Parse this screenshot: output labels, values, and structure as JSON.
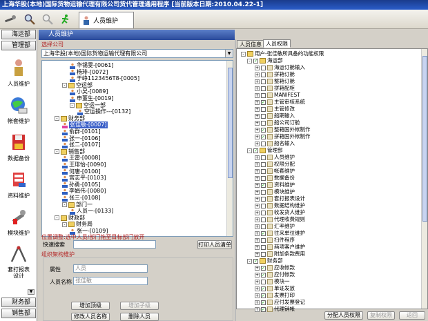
{
  "window": {
    "title": "上海华股(本地)国际货物运输代理有限公司货代管理通用程序   [当前版本日期:2010.04.22-1]"
  },
  "toolbar": {
    "tab_label": "人员维护"
  },
  "leftnav": {
    "group1": "海运部",
    "group2": "管理部",
    "items": [
      "人员维护",
      "帐套维护",
      "数据备份",
      "资料维护",
      "模块维护",
      "套打报表设计"
    ],
    "bottom1": "财务部",
    "bottom2": "销售部"
  },
  "main": {
    "panel_title": "人员维护",
    "section_company": "选择公司",
    "company_value": "上海华股(本地)国际货物运输代理有限公司",
    "tree": [
      {
        "t": "华锡雯-[0061]",
        "lv": 4,
        "icon": "user"
      },
      {
        "t": "杨琲-[0072]",
        "lv": 4,
        "icon": "user"
      },
      {
        "t": "于峥1123456T8-[0005]",
        "lv": 4,
        "icon": "user"
      },
      {
        "t": "空运部",
        "lv": 3,
        "icon": "folder",
        "pm": "-"
      },
      {
        "t": "小吴-[0089]",
        "lv": 4,
        "icon": "user"
      },
      {
        "t": "申董生-[0019]",
        "lv": 4,
        "icon": "user"
      },
      {
        "t": "空运一部",
        "lv": 4,
        "icon": "folder",
        "pm": "-"
      },
      {
        "t": "空运操作---[0132]",
        "lv": 5,
        "icon": "user"
      },
      {
        "t": "财务部",
        "lv": 2,
        "icon": "folder",
        "pm": "-"
      },
      {
        "t": "张佳敏-[0007]",
        "lv": 3,
        "icon": "user-pink",
        "sel": true
      },
      {
        "t": "俞群-[0101]",
        "lv": 3,
        "icon": "user"
      },
      {
        "t": "张一-[0106]",
        "lv": 3,
        "icon": "user"
      },
      {
        "t": "张二-[0107]",
        "lv": 3,
        "icon": "user"
      },
      {
        "t": "销售部",
        "lv": 2,
        "icon": "folder",
        "pm": "-"
      },
      {
        "t": "王雷-[0008]",
        "lv": 3,
        "icon": "user"
      },
      {
        "t": "王琲怡-[0090]",
        "lv": 3,
        "icon": "user"
      },
      {
        "t": "何唐-[0100]",
        "lv": 3,
        "icon": "user"
      },
      {
        "t": "宫志平-[0103]",
        "lv": 3,
        "icon": "user"
      },
      {
        "t": "孙勇-[0105]",
        "lv": 3,
        "icon": "user"
      },
      {
        "t": "李娟伟-[0080]",
        "lv": 3,
        "icon": "user"
      },
      {
        "t": "张三-[0108]",
        "lv": 3,
        "icon": "user"
      },
      {
        "t": "部门一",
        "lv": 3,
        "icon": "folder",
        "pm": "-"
      },
      {
        "t": "人员一-[0133]",
        "lv": 4,
        "icon": "user"
      },
      {
        "t": "财政部",
        "lv": 2,
        "icon": "folder",
        "pm": "-"
      },
      {
        "t": "财务局",
        "lv": 3,
        "icon": "folder",
        "pm": "-"
      },
      {
        "t": "张一-[0109]",
        "lv": 4,
        "icon": "user"
      }
    ],
    "hint": "位置调整:选中人员/部门拖至目标部门放开",
    "quick_search_label": "快速搜索",
    "print_button": "打印人员清单",
    "section_org": "组织架构维护",
    "attr_label": "属性",
    "attr_value": "人员",
    "name_label": "人员名称",
    "name_value": "张佳敏",
    "btn_add_top": "增加顶级",
    "btn_add_sub": "增加子级",
    "btn_modify": "修改人员名称",
    "btn_delete": "删除人员"
  },
  "right": {
    "tab_info": "人员信息",
    "tab_perm": "人员权限",
    "root": "用户-张佳敏所具备的功能权限",
    "nodes": [
      {
        "t": "海运部",
        "lv": 1,
        "pm": "-",
        "ck": true,
        "folder": true
      },
      {
        "t": "海运订舱输入",
        "lv": 2,
        "pm": "+",
        "ck": false
      },
      {
        "t": "拼箱订舱",
        "lv": 2,
        "pm": "+",
        "ck": false
      },
      {
        "t": "整箱订舱",
        "lv": 2,
        "pm": "+",
        "ck": false
      },
      {
        "t": "拼箱配柜",
        "lv": 2,
        "pm": "+",
        "ck": false
      },
      {
        "t": "MANIFEST",
        "lv": 2,
        "pm": "+",
        "ck": false
      },
      {
        "t": "主管审核系统",
        "lv": 2,
        "pm": "+",
        "ck": true
      },
      {
        "t": "主管修改",
        "lv": 2,
        "pm": "+",
        "ck": false
      },
      {
        "t": "船期输入",
        "lv": 2,
        "pm": "+",
        "ck": false
      },
      {
        "t": "船公司订舱",
        "lv": 2,
        "pm": "+",
        "ck": false
      },
      {
        "t": "整箱国外帐制作",
        "lv": 2,
        "pm": "+",
        "ck": true
      },
      {
        "t": "拼箱国外帐制作",
        "lv": 2,
        "pm": "+",
        "ck": true
      },
      {
        "t": "船名输入",
        "lv": 2,
        "pm": "+",
        "ck": false
      },
      {
        "t": "管理部",
        "lv": 1,
        "pm": "-",
        "ck": true,
        "folder": true
      },
      {
        "t": "人员维护",
        "lv": 2,
        "pm": "+",
        "ck": false
      },
      {
        "t": "权限分配",
        "lv": 2,
        "pm": "+",
        "ck": false
      },
      {
        "t": "帐套维护",
        "lv": 2,
        "pm": "+",
        "ck": false
      },
      {
        "t": "数据备份",
        "lv": 2,
        "pm": "+",
        "ck": false
      },
      {
        "t": "资料维护",
        "lv": 2,
        "pm": "+",
        "ck": true
      },
      {
        "t": "模块维护",
        "lv": 2,
        "pm": "+",
        "ck": false
      },
      {
        "t": "套打报表设计",
        "lv": 2,
        "pm": "+",
        "ck": false
      },
      {
        "t": "数据结构维护",
        "lv": 2,
        "pm": "+",
        "ck": false
      },
      {
        "t": "收发货人维护",
        "lv": 2,
        "pm": "+",
        "ck": false
      },
      {
        "t": "代理收费规则",
        "lv": 2,
        "pm": "+",
        "ck": false
      },
      {
        "t": "汇率维护",
        "lv": 2,
        "pm": "+",
        "ck": false
      },
      {
        "t": "往来单位维护",
        "lv": 2,
        "pm": "+",
        "ck": true
      },
      {
        "t": "扫件程序",
        "lv": 2,
        "pm": "+",
        "ck": false
      },
      {
        "t": "两项客户维护",
        "lv": 2,
        "pm": "+",
        "ck": false
      },
      {
        "t": "附加条款费用",
        "lv": 2,
        "pm": "+",
        "ck": false
      },
      {
        "t": "财务部",
        "lv": 1,
        "pm": "-",
        "ck": true,
        "folder": true
      },
      {
        "t": "应收帐款",
        "lv": 2,
        "pm": "+",
        "ck": true
      },
      {
        "t": "应付帐款",
        "lv": 2,
        "pm": "+",
        "ck": true
      },
      {
        "t": "模块一",
        "lv": 2,
        "pm": "+",
        "ck": false
      },
      {
        "t": "单证发放",
        "lv": 2,
        "pm": "+",
        "ck": true
      },
      {
        "t": "发票打印",
        "lv": 2,
        "pm": "+",
        "ck": true
      },
      {
        "t": "应付发票登记",
        "lv": 2,
        "pm": "+",
        "ck": true
      },
      {
        "t": "代理销帐",
        "lv": 2,
        "pm": "+",
        "ck": true
      }
    ],
    "btn_assign": "分配人员权限",
    "btn_copy": "复制权限",
    "btn_back": "返回"
  }
}
